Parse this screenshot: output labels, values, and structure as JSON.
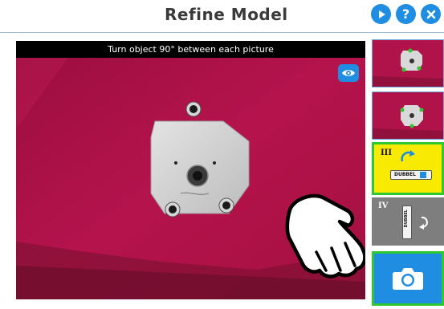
{
  "header": {
    "title": "Refine Model",
    "buttons": [
      {
        "name": "play",
        "icon": "play-icon"
      },
      {
        "name": "help",
        "icon": "question-icon",
        "glyph": "?"
      },
      {
        "name": "close",
        "icon": "close-icon"
      }
    ]
  },
  "camera": {
    "instruction": "Turn object 90° between each picture",
    "eye_icon": "eye-icon",
    "background_color": "#b0124a"
  },
  "steps": [
    {
      "roman": "",
      "state": "captured"
    },
    {
      "roman": "",
      "state": "captured"
    },
    {
      "roman": "III",
      "state": "current",
      "highlight": "#f8ea00",
      "device_label": "DUBBEL"
    },
    {
      "roman": "IV",
      "state": "pending",
      "device_label": "DUBBEL"
    }
  ],
  "capture_button": {
    "icon": "camera-icon",
    "border_color": "#2ec830"
  }
}
